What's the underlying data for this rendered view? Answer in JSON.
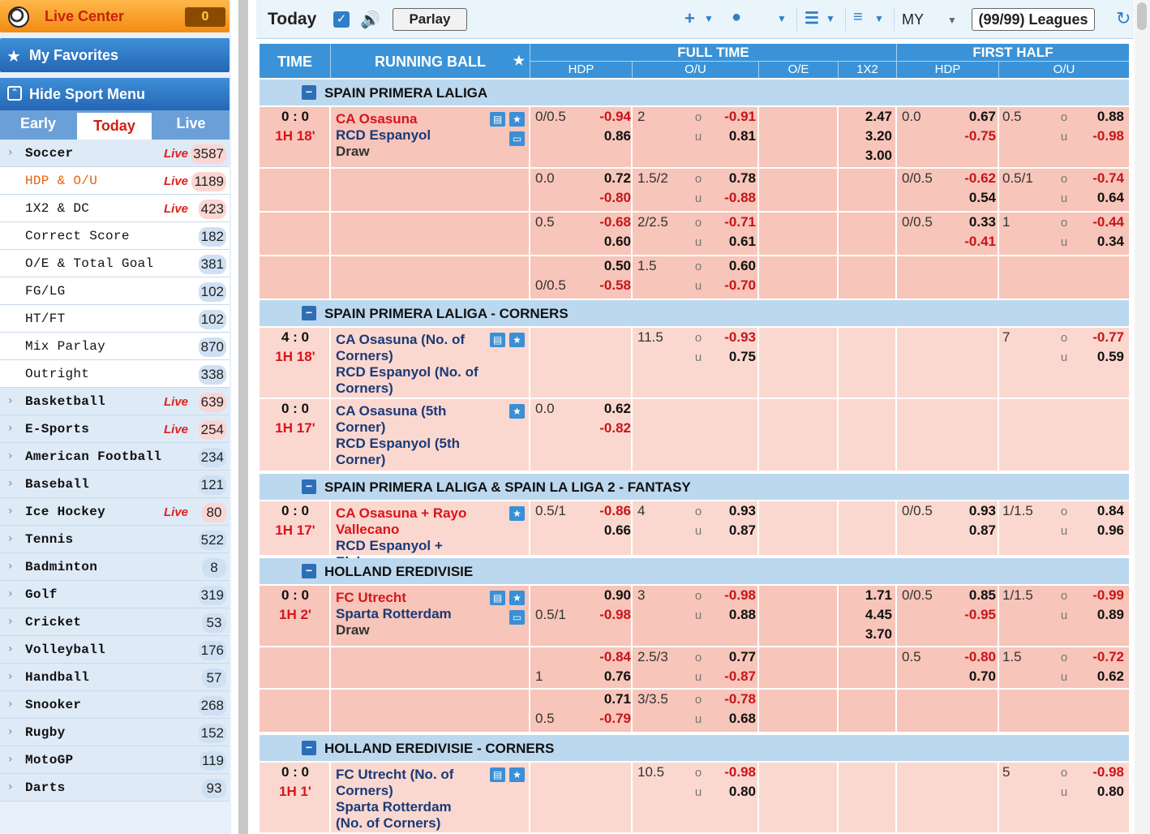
{
  "sidebar": {
    "live_center": {
      "label": "Live Center",
      "count": "0"
    },
    "favorites": {
      "label": "My Favorites"
    },
    "hide_menu": {
      "label": "Hide Sport Menu"
    },
    "tabs": [
      {
        "label": "Early"
      },
      {
        "label": "Today"
      },
      {
        "label": "Live"
      }
    ],
    "items": [
      {
        "label": "Soccer",
        "live": "Live",
        "count": "3587",
        "sub": false
      },
      {
        "label": "HDP & O/U",
        "live": "Live",
        "count": "1189",
        "sub": true
      },
      {
        "label": "1X2 & DC",
        "live": "Live",
        "count": "423",
        "sub": true
      },
      {
        "label": "Correct Score",
        "live": "",
        "count": "182",
        "sub": true
      },
      {
        "label": "O/E & Total Goal",
        "live": "",
        "count": "381",
        "sub": true
      },
      {
        "label": "FG/LG",
        "live": "",
        "count": "102",
        "sub": true
      },
      {
        "label": "HT/FT",
        "live": "",
        "count": "102",
        "sub": true
      },
      {
        "label": "Mix Parlay",
        "live": "",
        "count": "870",
        "sub": true
      },
      {
        "label": "Outright",
        "live": "",
        "count": "338",
        "sub": true
      },
      {
        "label": "Basketball",
        "live": "Live",
        "count": "639",
        "sub": false
      },
      {
        "label": "E-Sports",
        "live": "Live",
        "count": "254",
        "sub": false
      },
      {
        "label": "American Football",
        "live": "",
        "count": "234",
        "sub": false
      },
      {
        "label": "Baseball",
        "live": "",
        "count": "121",
        "sub": false
      },
      {
        "label": "Ice Hockey",
        "live": "Live",
        "count": "80",
        "sub": false
      },
      {
        "label": "Tennis",
        "live": "",
        "count": "522",
        "sub": false
      },
      {
        "label": "Badminton",
        "live": "",
        "count": "8",
        "sub": false
      },
      {
        "label": "Golf",
        "live": "",
        "count": "319",
        "sub": false
      },
      {
        "label": "Cricket",
        "live": "",
        "count": "53",
        "sub": false
      },
      {
        "label": "Volleyball",
        "live": "",
        "count": "176",
        "sub": false
      },
      {
        "label": "Handball",
        "live": "",
        "count": "57",
        "sub": false
      },
      {
        "label": "Snooker",
        "live": "",
        "count": "268",
        "sub": false
      },
      {
        "label": "Rugby",
        "live": "",
        "count": "152",
        "sub": false
      },
      {
        "label": "MotoGP",
        "live": "",
        "count": "119",
        "sub": false
      },
      {
        "label": "Darts",
        "live": "",
        "count": "93",
        "sub": false
      }
    ]
  },
  "toolbar": {
    "title": "Today",
    "parlay": "Parlay",
    "odds_type": "MY",
    "leagues": "(99/99) Leagues"
  },
  "table_header": {
    "time": "TIME",
    "running_ball": "RUNNING BALL",
    "full_time": "FULL TIME",
    "first_half": "FIRST HALF",
    "hdp": "HDP",
    "ou": "O/U",
    "oe": "O/E",
    "x12": "1X2",
    "fh_hdp": "HDP",
    "fh_ou": "O/U"
  },
  "leagues": [
    {
      "name": "SPAIN PRIMERA LALIGA"
    },
    {
      "name": "SPAIN PRIMERA LALIGA - CORNERS"
    },
    {
      "name": "SPAIN PRIMERA LALIGA & SPAIN LA LIGA 2 - FANTASY"
    },
    {
      "name": "HOLLAND EREDIVISIE"
    },
    {
      "name": "HOLLAND EREDIVISIE - CORNERS"
    }
  ],
  "matches": {
    "m1": {
      "score": "0 : 0",
      "clock": "1H 18'",
      "home": "CA Osasuna",
      "away": "RCD Espanyol",
      "draw": "Draw",
      "rows": [
        [
          "0/0.5",
          "-0.94",
          "0.86",
          "2",
          "-0.91",
          "0.81",
          "2.47",
          "3.20",
          "3.00",
          "0.0",
          "0.67",
          "-0.75",
          "0.5",
          "0.88",
          "-0.98"
        ],
        [
          "0.0",
          "0.72",
          "-0.80",
          "1.5/2",
          "0.78",
          "-0.88",
          "",
          "",
          "",
          "0/0.5",
          "-0.62",
          "0.54",
          "0.5/1",
          "-0.74",
          "0.64"
        ],
        [
          "0.5",
          "-0.68",
          "0.60",
          "2/2.5",
          "-0.71",
          "0.61",
          "",
          "",
          "",
          "0/0.5",
          "0.33",
          "-0.41",
          "1",
          "-0.44",
          "0.34"
        ],
        [
          "0/0.5",
          "0.50",
          "-0.58",
          "1.5",
          "0.60",
          "-0.70",
          "",
          "",
          "",
          "",
          "",
          "",
          "",
          "",
          ""
        ]
      ]
    },
    "m2": {
      "score": "4 : 0",
      "clock": "1H 18'",
      "home": "CA Osasuna (No. of Corners)",
      "away": "RCD Espanyol (No. of Corners)",
      "ou_line": "11.5",
      "o": "-0.93",
      "u": "0.75",
      "fh_ou_line": "7",
      "fh_o": "-0.77",
      "fh_u": "0.59"
    },
    "m3": {
      "score": "0 : 0",
      "clock": "1H 17'",
      "home": "CA Osasuna (5th Corner)",
      "away": "RCD Espanyol (5th Corner)",
      "hdp_line": "0.0",
      "h": "0.62",
      "a": "-0.82"
    },
    "m4": {
      "score": "0 : 0",
      "clock": "1H 17'",
      "home": "CA Osasuna + Rayo Vallecano",
      "away": "RCD Espanyol + Elche",
      "row": [
        "0.5/1",
        "-0.86",
        "0.66",
        "4",
        "0.93",
        "0.87",
        "0/0.5",
        "0.93",
        "0.87",
        "1/1.5",
        "0.84",
        "0.96"
      ]
    },
    "m5": {
      "score": "0 : 0",
      "clock": "1H 2'",
      "home": "FC Utrecht",
      "away": "Sparta Rotterdam",
      "draw": "Draw",
      "rows": [
        [
          "0.5/1",
          "0.90",
          "-0.98",
          "3",
          "-0.98",
          "0.88",
          "1.71",
          "4.45",
          "3.70",
          "0/0.5",
          "0.85",
          "-0.95",
          "1/1.5",
          "-0.99",
          "0.89"
        ],
        [
          "1",
          "-0.84",
          "0.76",
          "2.5/3",
          "0.77",
          "-0.87",
          "",
          "",
          "",
          "0.5",
          "-0.80",
          "0.70",
          "1.5",
          "-0.72",
          "0.62"
        ],
        [
          "0.5",
          "0.71",
          "-0.79",
          "3/3.5",
          "-0.78",
          "0.68",
          "",
          "",
          "",
          "",
          "",
          "",
          "",
          "",
          ""
        ]
      ]
    },
    "m6": {
      "score": "0 : 0",
      "clock": "1H 1'",
      "home": "FC Utrecht (No. of Corners)",
      "away": "Sparta Rotterdam (No. of Corners)",
      "ou_line": "10.5",
      "o": "-0.98",
      "u": "0.80",
      "fh_ou_line": "5",
      "fh_o": "-0.98",
      "fh_u": "0.80"
    }
  },
  "ou_labels": {
    "o": "o",
    "u": "u"
  }
}
